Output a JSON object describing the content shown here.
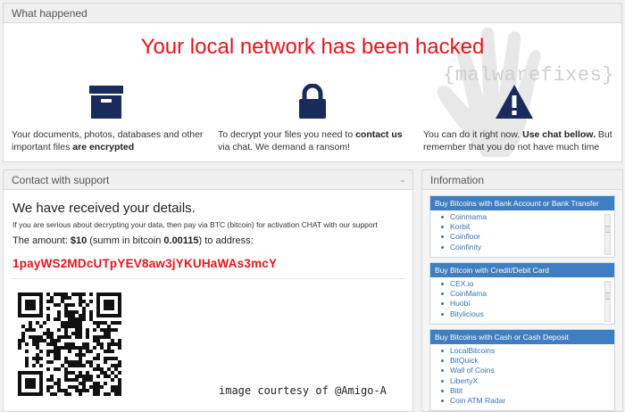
{
  "what_happened": {
    "header": "What happened",
    "headline": "Your local network has been hacked",
    "watermark": "{malwarefixes}",
    "col1": {
      "text": "Your documents, photos, databases and other important files ",
      "bold": "are encrypted"
    },
    "col2": {
      "text1": "To decrypt your files you need to ",
      "bold": "contact us",
      "text2": " via chat. We demand a ransom!"
    },
    "col3": {
      "text1": "You can do it right now. ",
      "bold": "Use chat bellow.",
      "text2": " But remember that you do not have much time"
    },
    "icons": [
      "archive-box-icon",
      "padlock-icon",
      "warning-icon"
    ]
  },
  "support": {
    "header": "Contact with support",
    "collapse": "-",
    "received": "We have received your details.",
    "serious": "If you are serious about decrypting your data, then pay via BTC (bitcoin) for activation CHAT with our support",
    "amount_prefix": "The amount: ",
    "amount_value": "$10",
    "amount_mid": " (summ in bitcoin ",
    "amount_btc": "0.00115",
    "amount_suffix": ") to address:",
    "btc_address": "1payWS2MDcUTpYEV8aw3jYKUHaWAs3mcY",
    "credit": "image courtesy of @Amigo-A"
  },
  "information": {
    "header": "Information",
    "boxes": [
      {
        "title": "Buy Bitcoins with Bank Account or Bank Transfer",
        "items": [
          "Coinmama",
          "Korbit",
          "Coinfloor",
          "Coinfinity"
        ]
      },
      {
        "title": "Buy Bitcoin with Credit/Debit Card",
        "items": [
          "CEX.io",
          "CoinMama",
          "Huobi",
          "Bitylicious"
        ]
      },
      {
        "title": "Buy Bitcoins with Cash or Cash Deposit",
        "items": [
          "LocalBitcoins",
          "BitQuick",
          "Wall of Coins",
          "LibertyX",
          "Bitit",
          "Coin ATM Radar"
        ]
      }
    ]
  },
  "colors": {
    "alert_red": "#e8141a",
    "navy": "#1a2a5c",
    "link_blue": "#3573b5",
    "box_head": "#3f7ec1"
  }
}
